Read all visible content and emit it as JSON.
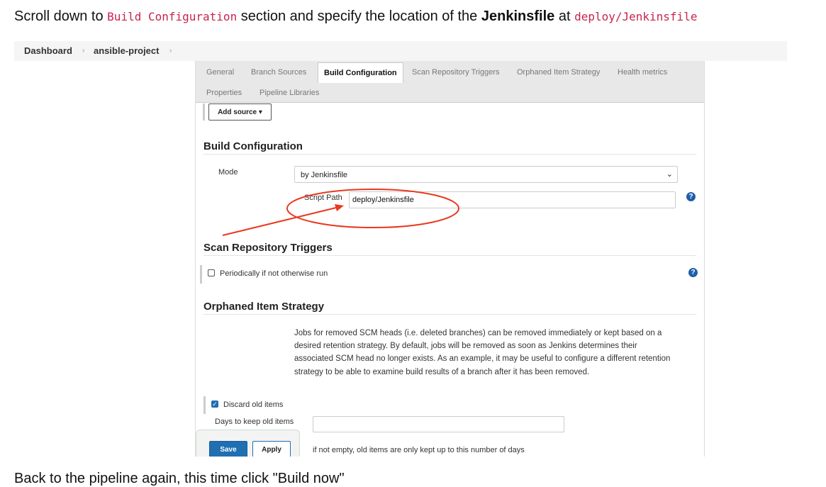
{
  "instruction": {
    "prefix": "Scroll down to ",
    "section_code": "Build Configuration",
    "middle": " section and specify the location of the ",
    "jenkinsfile_bold": "Jenkinsfile",
    "at": " at ",
    "path_code": "deploy/Jenkinsfile"
  },
  "breadcrumb": {
    "items": [
      "Dashboard",
      "ansible-project"
    ],
    "separator": "›"
  },
  "tabs": [
    {
      "label": "General"
    },
    {
      "label": "Branch Sources"
    },
    {
      "label": "Build Configuration",
      "active": true
    },
    {
      "label": "Scan Repository Triggers"
    },
    {
      "label": "Orphaned Item Strategy"
    },
    {
      "label": "Health metrics"
    },
    {
      "label": "Properties"
    },
    {
      "label": "Pipeline Libraries"
    }
  ],
  "add_source": {
    "label": "Add source",
    "caret": "▾"
  },
  "build_config": {
    "title": "Build Configuration",
    "mode_label": "Mode",
    "mode_value": "by Jenkinsfile",
    "script_path_label": "Script Path",
    "script_path_value": "deploy/Jenkinsfile"
  },
  "scan_triggers": {
    "title": "Scan Repository Triggers",
    "periodic_label": "Periodically if not otherwise run",
    "periodic_checked": false
  },
  "orphaned": {
    "title": "Orphaned Item Strategy",
    "description": "Jobs for removed SCM heads (i.e. deleted branches) can be removed immediately or kept based on a desired retention strategy. By default, jobs will be removed as soon as Jenkins determines their associated SCM head no longer exists. As an example, it may be useful to configure a different retention strategy to be able to examine build results of a branch after it has been removed.",
    "discard_label": "Discard old items",
    "discard_checked": true,
    "days_label": "Days to keep old items",
    "days_value": "",
    "days_hint": "if not empty, old items are only kept up to this number of days"
  },
  "help_glyph": "?",
  "checkmark_glyph": "✓",
  "buttons": {
    "save": "Save",
    "apply": "Apply"
  },
  "colors": {
    "annotation": "#e8391f",
    "primary": "#1f6fb2",
    "code": "#c7254e"
  },
  "footer_text": "Back to the pipeline again, this time click \"Build now\""
}
